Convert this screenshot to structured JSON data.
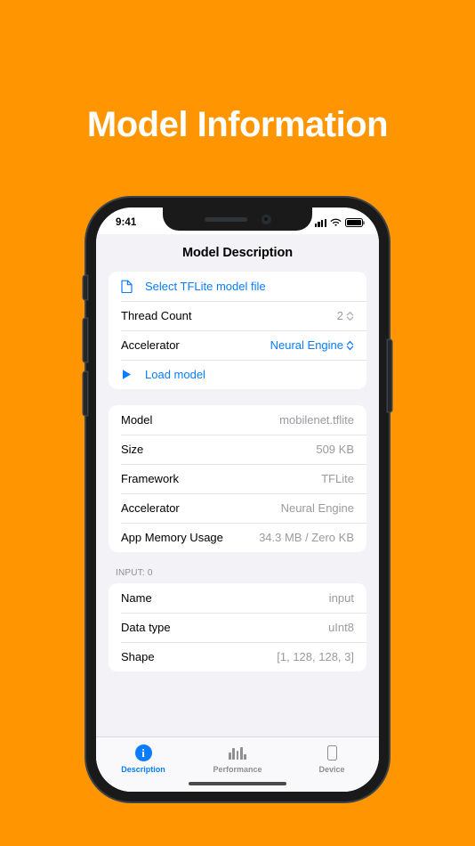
{
  "page": {
    "heading": "Model Information",
    "background_color": "#FF9500"
  },
  "theme": {
    "accent_blue": "#0A7CFF",
    "screen_background": "#F2F2F7",
    "card_background": "#FFFFFF",
    "muted_text": "#9A9AA0"
  },
  "status_bar": {
    "time": "9:41",
    "cellular_icon": "signal-bars-icon",
    "wifi_icon": "wifi-icon",
    "battery_icon": "battery-full-icon"
  },
  "nav": {
    "title": "Model Description"
  },
  "setup_card": {
    "select_file": {
      "icon": "document-icon",
      "label": "Select TFLite model file"
    },
    "thread_count": {
      "label": "Thread Count",
      "value": "2",
      "stepper_icon": "chevron-up-down-icon"
    },
    "accelerator": {
      "label": "Accelerator",
      "value": "Neural Engine",
      "stepper_icon": "chevron-up-down-icon"
    },
    "load_model": {
      "icon": "play-icon",
      "label": "Load model"
    }
  },
  "info_card": {
    "rows": [
      {
        "label": "Model",
        "value": "mobilenet.tflite"
      },
      {
        "label": "Size",
        "value": "509 KB"
      },
      {
        "label": "Framework",
        "value": "TFLite"
      },
      {
        "label": "Accelerator",
        "value": "Neural Engine"
      },
      {
        "label": "App Memory Usage",
        "value": "34.3 MB / Zero KB"
      }
    ]
  },
  "input_section": {
    "header": "INPUT: 0",
    "rows": [
      {
        "label": "Name",
        "value": "input"
      },
      {
        "label": "Data type",
        "value": "uInt8"
      },
      {
        "label": "Shape",
        "value": "[1, 128, 128, 3]"
      }
    ]
  },
  "tabbar": {
    "tabs": [
      {
        "label": "Description",
        "icon": "info-circle-icon",
        "active": true
      },
      {
        "label": "Performance",
        "icon": "bar-chart-icon",
        "active": false
      },
      {
        "label": "Device",
        "icon": "phone-icon",
        "active": false
      }
    ]
  }
}
